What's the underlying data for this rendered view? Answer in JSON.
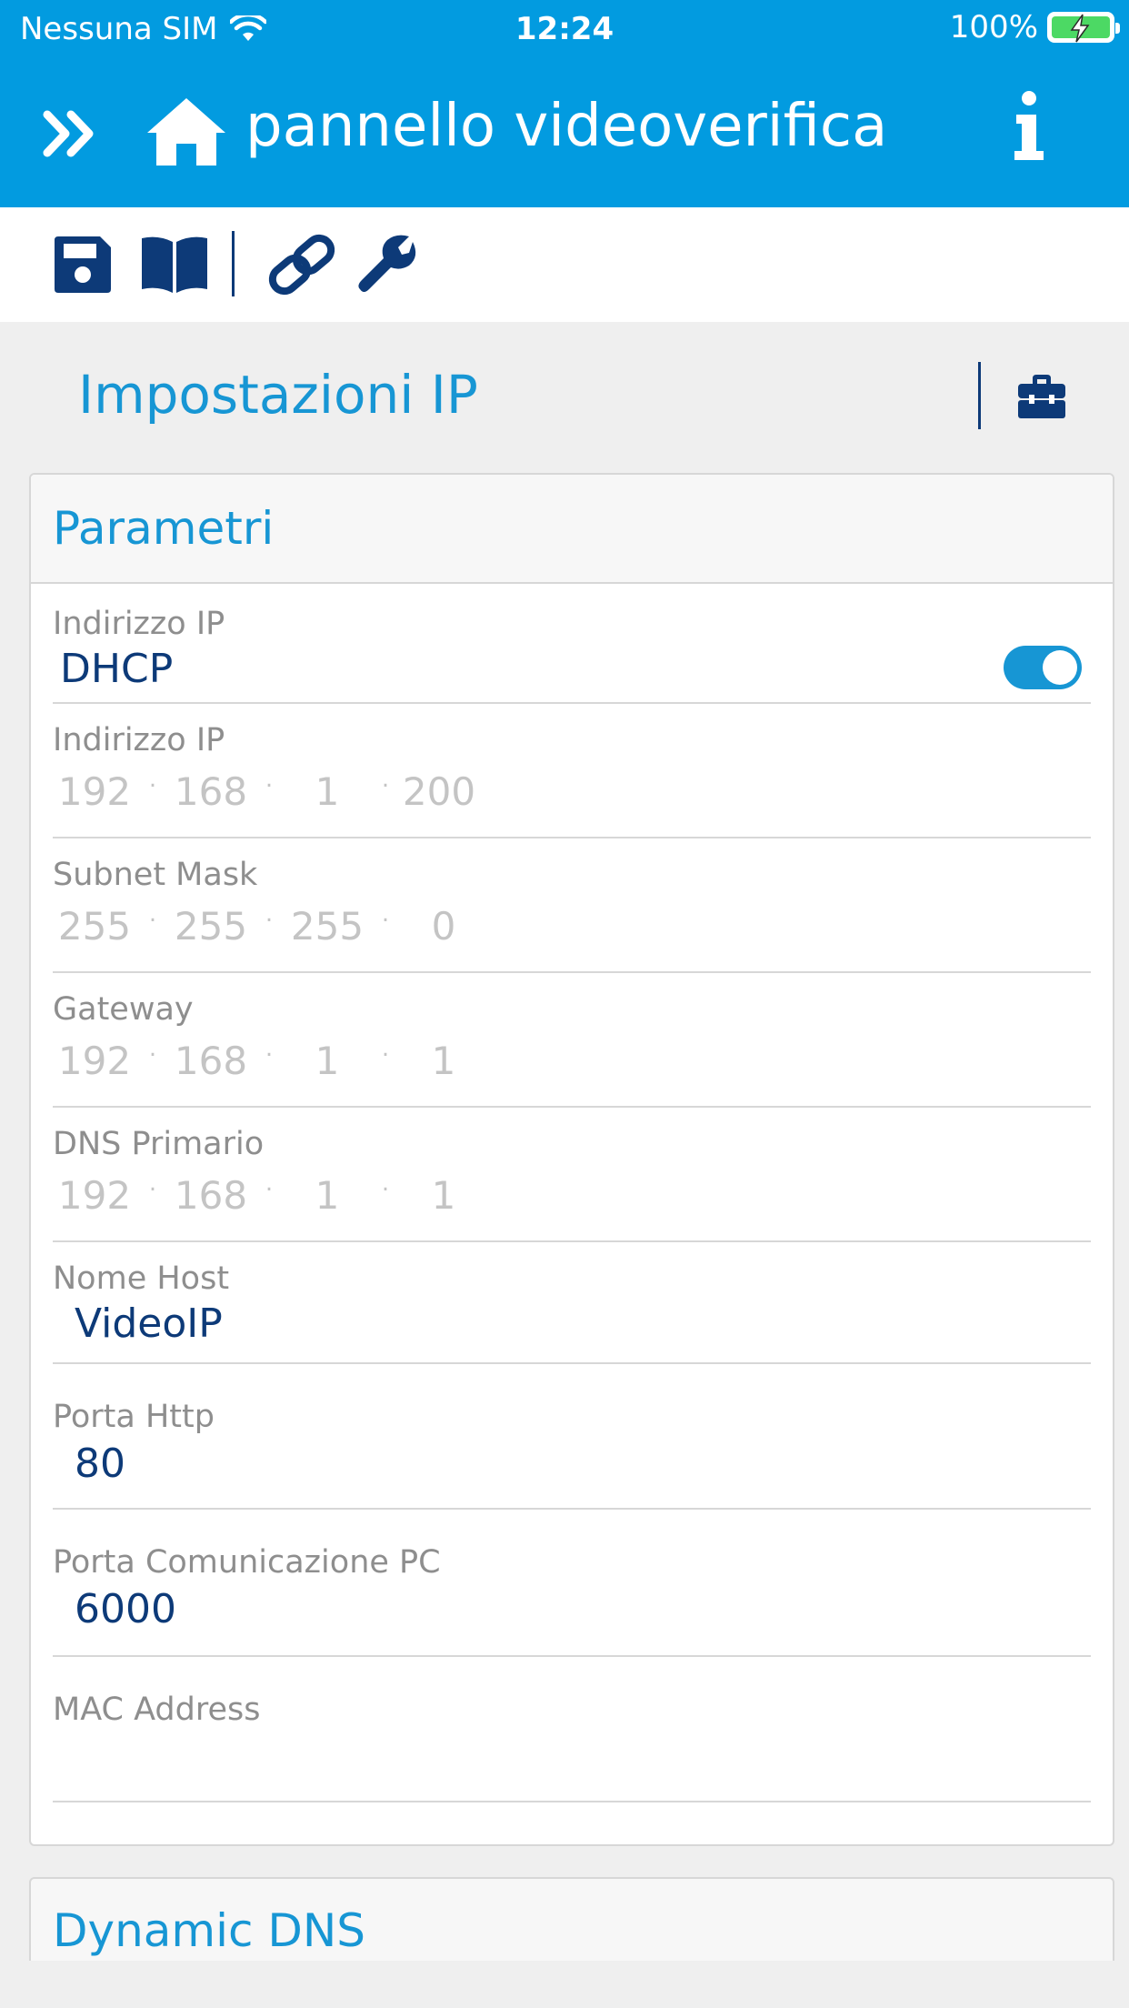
{
  "status_bar": {
    "carrier": "Nessuna SIM",
    "time": "12:24",
    "battery": "100%"
  },
  "header": {
    "title": "pannello videoverifica"
  },
  "section": {
    "title": "Impostazioni IP"
  },
  "card": {
    "title": "Parametri",
    "dhcp": {
      "label": "Indirizzo IP",
      "value": "DHCP",
      "enabled": true
    },
    "ip_address": {
      "label": "Indirizzo IP",
      "octets": [
        "192",
        "168",
        "1",
        "200"
      ]
    },
    "subnet_mask": {
      "label": "Subnet Mask",
      "octets": [
        "255",
        "255",
        "255",
        "0"
      ]
    },
    "gateway": {
      "label": "Gateway",
      "octets": [
        "192",
        "168",
        "1",
        "1"
      ]
    },
    "dns_primary": {
      "label": "DNS Primario",
      "octets": [
        "192",
        "168",
        "1",
        "1"
      ]
    },
    "host_name": {
      "label": "Nome Host",
      "value": "VideoIP"
    },
    "http_port": {
      "label": "Porta Http",
      "value": "80"
    },
    "pc_port": {
      "label": "Porta Comunicazione PC",
      "value": "6000"
    },
    "mac_address": {
      "label": "MAC Address",
      "value": ""
    }
  },
  "card2": {
    "title": "Dynamic DNS"
  },
  "colors": {
    "primary": "#029be0",
    "accent": "#1796d4",
    "icon_navy": "#0d3a78"
  },
  "icons": [
    "wifi-icon",
    "battery-icon",
    "double-chevron-right-icon",
    "home-icon",
    "info-icon",
    "save-icon",
    "book-icon",
    "link-icon",
    "wrench-icon",
    "toolbox-icon"
  ]
}
